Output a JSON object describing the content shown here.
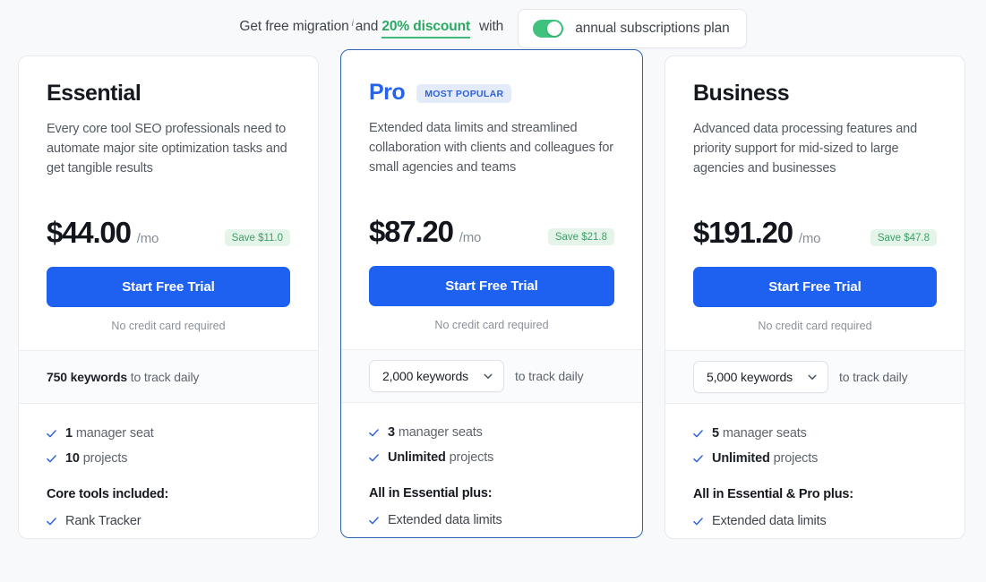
{
  "promo": {
    "lead": "Get free migration",
    "info_marker": "i",
    "and": "and",
    "discount": "20% discount",
    "with": "with",
    "toggle_label": "annual subscriptions plan",
    "toggle_on": true,
    "accent_green": "#2aa862",
    "toggle_color": "#3ec27e"
  },
  "plans": [
    {
      "name": "Essential",
      "badge": "",
      "description": "Every core tool SEO professionals need to automate major site optimization tasks and get tangible results",
      "price": "$44.00",
      "period": "/mo",
      "save": "Save $11.0",
      "cta": "Start Free Trial",
      "note": "No credit card required",
      "keywords_value": "750 keywords",
      "keywords_suffix": "to track daily",
      "keywords_is_select": false,
      "seats_value": "1",
      "seats_label": "manager seat",
      "projects_value": "10",
      "projects_label": "projects",
      "group_title": "Core tools included:",
      "group_items": [
        "Rank Tracker"
      ]
    },
    {
      "name": "Pro",
      "badge": "MOST POPULAR",
      "description": "Extended data limits and streamlined collaboration with clients and colleagues for small agencies and teams",
      "price": "$87.20",
      "period": "/mo",
      "save": "Save $21.8",
      "cta": "Start Free Trial",
      "note": "No credit card required",
      "keywords_value": "2,000 keywords",
      "keywords_suffix": "to track daily",
      "keywords_is_select": true,
      "seats_value": "3",
      "seats_label": "manager seats",
      "projects_value": "Unlimited",
      "projects_label": "projects",
      "group_title": "All in Essential plus:",
      "group_items": [
        "Extended data limits"
      ]
    },
    {
      "name": "Business",
      "badge": "",
      "description": "Advanced data processing features and priority support for mid-sized to large agencies and businesses",
      "price": "$191.20",
      "period": "/mo",
      "save": "Save $47.8",
      "cta": "Start Free Trial",
      "note": "No credit card required",
      "keywords_value": "5,000 keywords",
      "keywords_suffix": "to track daily",
      "keywords_is_select": true,
      "seats_value": "5",
      "seats_label": "manager seats",
      "projects_value": "Unlimited",
      "projects_label": "projects",
      "group_title": "All in Essential & Pro plus:",
      "group_items": [
        "Extended data limits"
      ]
    }
  ],
  "theme": {
    "primary_blue": "#1e60f0",
    "accent_blue": "#2563eb",
    "save_green": "#3f9e67",
    "page_bg": "#f8f9fb"
  }
}
